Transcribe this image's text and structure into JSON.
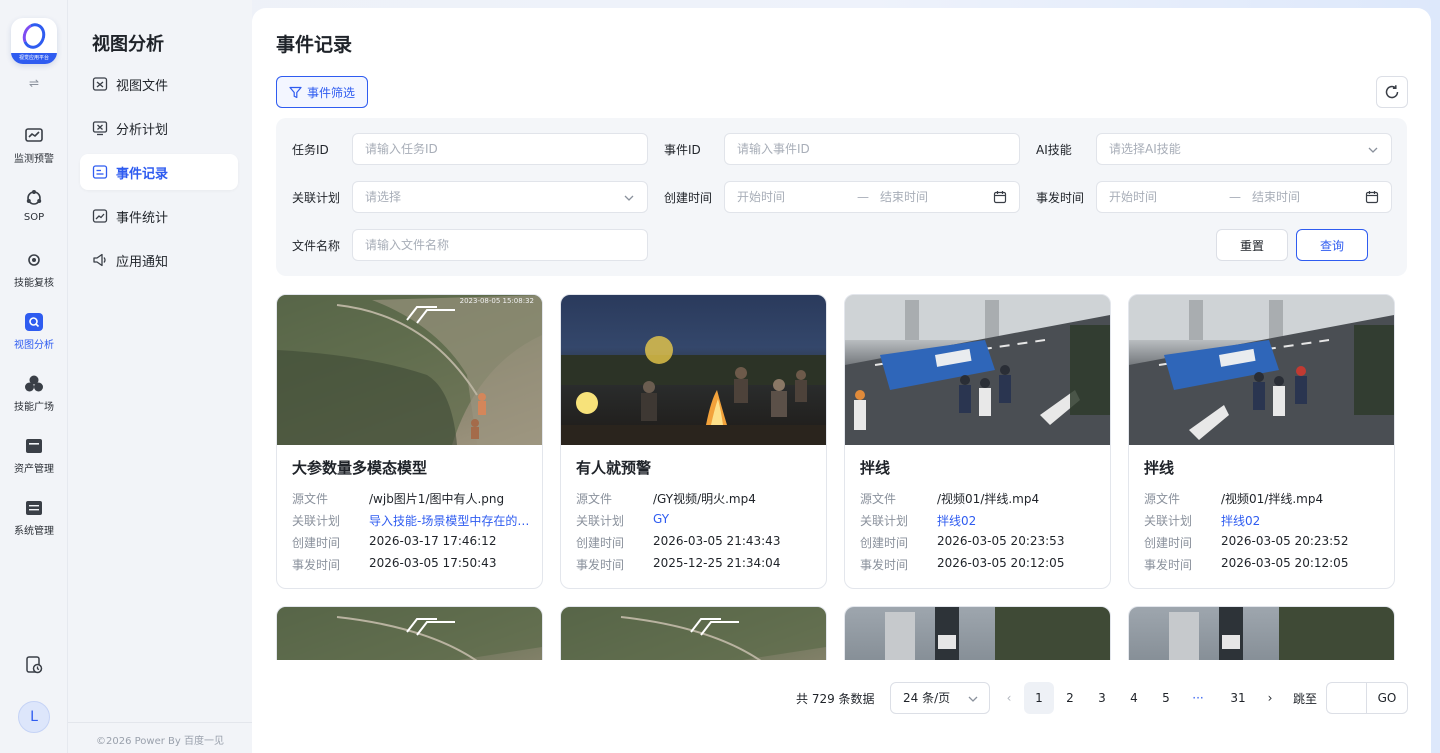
{
  "brand": {
    "logo_tag": "视觉应用平台",
    "accent": "#2f5cf0"
  },
  "rail": {
    "items": [
      {
        "label": "监测预警",
        "icon": "monitor-icon"
      },
      {
        "label": "SOP",
        "icon": "sop-icon"
      },
      {
        "label": "技能复核",
        "icon": "review-icon"
      },
      {
        "label": "视图分析",
        "icon": "view-analysis-icon",
        "active": true
      },
      {
        "label": "技能广场",
        "icon": "skill-plaza-icon"
      },
      {
        "label": "资产管理",
        "icon": "asset-icon"
      },
      {
        "label": "系统管理",
        "icon": "system-icon"
      }
    ],
    "avatar": "L"
  },
  "subnav": {
    "title": "视图分析",
    "items": [
      {
        "label": "视图文件",
        "icon": "file-icon"
      },
      {
        "label": "分析计划",
        "icon": "plan-icon"
      },
      {
        "label": "事件记录",
        "icon": "record-icon",
        "active": true
      },
      {
        "label": "事件统计",
        "icon": "stats-icon"
      },
      {
        "label": "应用通知",
        "icon": "notify-icon"
      }
    ],
    "copyright": "©2026 Power By 百度一见"
  },
  "page": {
    "title": "事件记录",
    "filter_button": "事件筛选"
  },
  "filters": {
    "task_id": {
      "label": "任务ID",
      "placeholder": "请输入任务ID"
    },
    "event_id": {
      "label": "事件ID",
      "placeholder": "请输入事件ID"
    },
    "ai_skill": {
      "label": "AI技能",
      "placeholder": "请选择AI技能"
    },
    "plan": {
      "label": "关联计划",
      "placeholder": "请选择"
    },
    "created": {
      "label": "创建时间",
      "start": "开始时间",
      "end": "结束时间",
      "sep": "—"
    },
    "occurred": {
      "label": "事发时间",
      "start": "开始时间",
      "end": "结束时间",
      "sep": "—"
    },
    "file_name": {
      "label": "文件名称",
      "placeholder": "请输入文件名称"
    },
    "reset": "重置",
    "query": "查询"
  },
  "meta_labels": {
    "source": "源文件",
    "plan": "关联计划",
    "created": "创建时间",
    "occurred": "事发时间"
  },
  "cards": [
    {
      "title": "大参数量多模态模型",
      "source": "/wjb图片1/图中有人.png",
      "plan": "导入技能-场景模型中存在的技能",
      "created": "2026-03-17 17:46:12",
      "occurred": "2026-03-05 17:50:43",
      "stamp": "2023-08-05 15:08:32"
    },
    {
      "title": "有人就预警",
      "source": "/GY视频/明火.mp4",
      "plan": "GY",
      "created": "2026-03-05 21:43:43",
      "occurred": "2025-12-25 21:34:04"
    },
    {
      "title": "拌线",
      "source": "/视频01/拌线.mp4",
      "plan": "拌线02",
      "created": "2026-03-05 20:23:53",
      "occurred": "2026-03-05 20:12:05"
    },
    {
      "title": "拌线",
      "source": "/视频01/拌线.mp4",
      "plan": "拌线02",
      "created": "2026-03-05 20:23:52",
      "occurred": "2026-03-05 20:12:05"
    }
  ],
  "pagination": {
    "total": "共 729 条数据",
    "page_size": "24 条/页",
    "pages": [
      "1",
      "2",
      "3",
      "4",
      "5",
      "···",
      "31"
    ],
    "current": "1",
    "jump_label": "跳至",
    "go": "GO"
  }
}
